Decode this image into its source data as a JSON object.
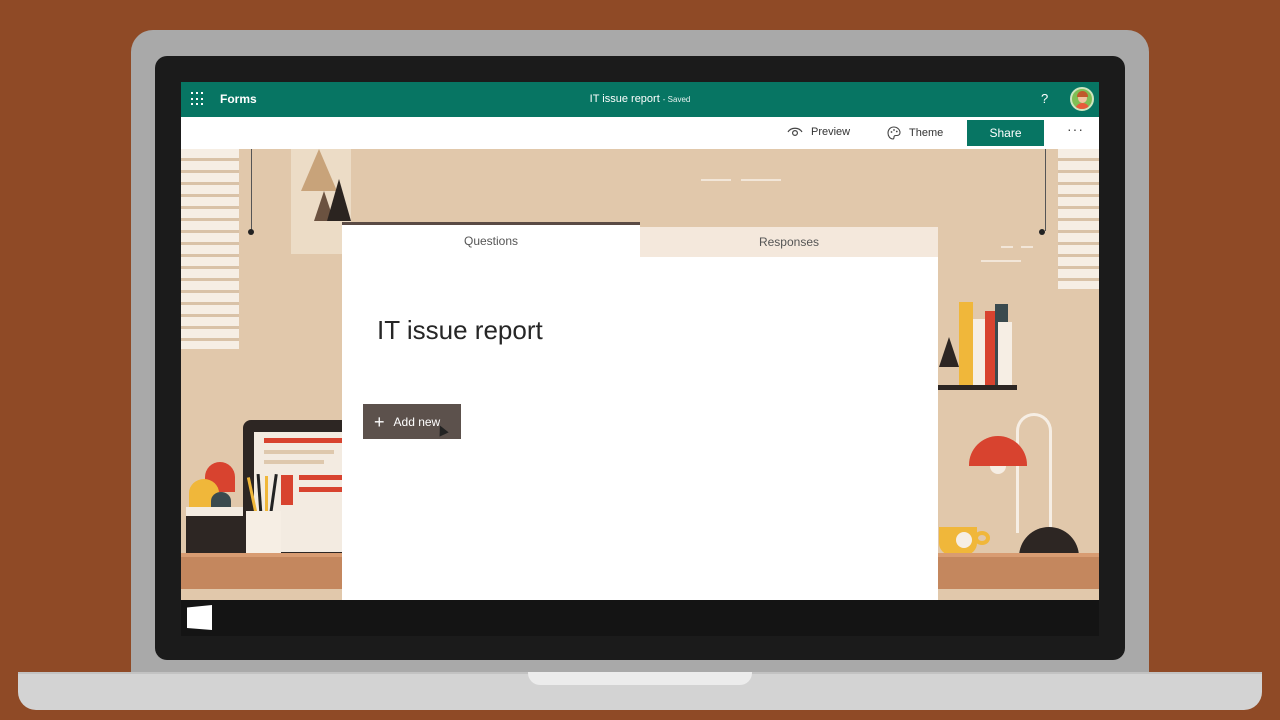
{
  "suitebar": {
    "app_name": "Forms",
    "doc_title": "IT issue report",
    "doc_status": "- Saved",
    "help_label": "?",
    "waffle_icon": "waffle-icon",
    "avatar_icon": "user-avatar"
  },
  "commandbar": {
    "preview_label": "Preview",
    "preview_icon": "eye-icon",
    "theme_label": "Theme",
    "theme_icon": "palette-icon",
    "share_label": "Share",
    "more_label": "···"
  },
  "tabs": [
    {
      "label": "Questions",
      "active": true
    },
    {
      "label": "Responses",
      "active": false
    }
  ],
  "form": {
    "title": "IT issue report",
    "add_new_label": "Add new",
    "add_new_icon": "plus-icon"
  },
  "colors": {
    "brand": "#077563",
    "add_button": "#5c514c",
    "background": "#8f4a26"
  }
}
